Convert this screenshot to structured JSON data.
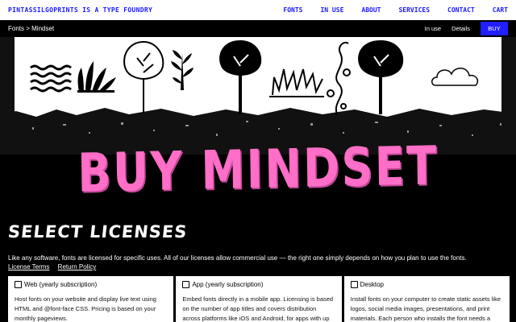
{
  "header": {
    "brand": "PINTASSILGOPRINTS IS A TYPE FOUNDRY",
    "nav": [
      "FONTS",
      "IN USE",
      "ABOUT",
      "SERVICES",
      "CONTACT",
      "CART"
    ]
  },
  "subnav": {
    "breadcrumb": "Fonts > Mindset",
    "links": [
      "In use",
      "Details"
    ],
    "buy_label": "BUY"
  },
  "hero": {
    "title": "BUY MINDSET"
  },
  "licenses": {
    "heading": "SELECT LICENSES",
    "intro": "Like any software, fonts are licensed for specific uses. All of our licenses allow commercial use — the right one simply depends on how you plan to use the fonts.",
    "links": [
      "License Terms",
      "Return Policy"
    ],
    "cards": [
      {
        "label": "Web (yearly subscription)",
        "desc": "Host fonts on your website and display live text using HTML and @font-face CSS. Pricing is based on your monthly pageviews."
      },
      {
        "label": "App (yearly subscription)",
        "desc": "Embed fonts directly in a mobile app. Licensing is based on the number of app titles and covers distribution across platforms like iOS and Android, for apps with up"
      },
      {
        "label": "Desktop",
        "desc": "Install fonts on your computer to create static assets like logos, social media images, presentations, and print materials. Each person who installs the font needs a"
      }
    ]
  },
  "colors": {
    "accent": "#1f1fff",
    "title_pink": "#ff6ec7"
  }
}
